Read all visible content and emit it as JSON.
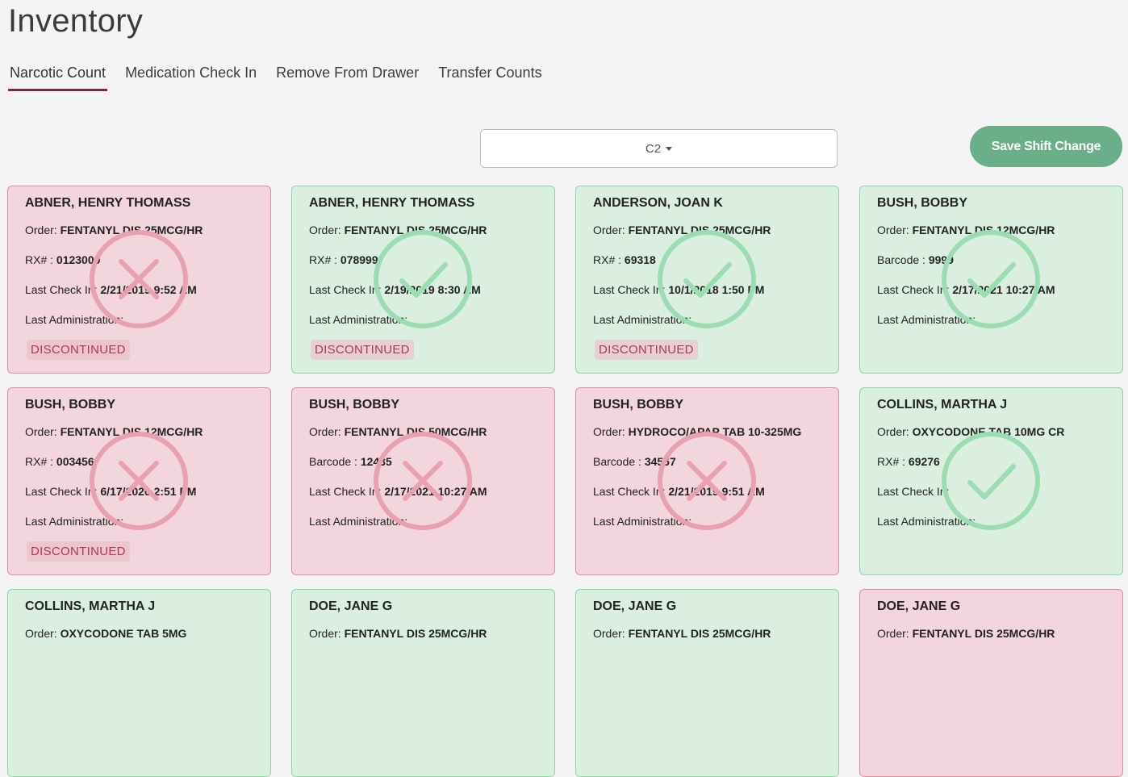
{
  "page": {
    "title": "Inventory"
  },
  "tabs": [
    {
      "label": "Narcotic Count",
      "active": true
    },
    {
      "label": "Medication Check In",
      "active": false
    },
    {
      "label": "Remove From Drawer",
      "active": false
    },
    {
      "label": "Transfer Counts",
      "active": false
    }
  ],
  "drawer_select": {
    "value": "C2"
  },
  "save_button": {
    "label": "Save Shift Change"
  },
  "labels": {
    "order": "Order: ",
    "last_check_in": "Last Check In: ",
    "last_administration": "Last Administration:"
  },
  "colors": {
    "error": "#e8a1b1",
    "success": "#9bdcb0",
    "accent": "#7a2853",
    "button": "#6aae8a"
  },
  "cards": [
    {
      "patient": "ABNER, HENRY THOMASS",
      "order": "FENTANYL DIS 25MCG/HR",
      "id_label": "RX# : ",
      "id_value": "0123000",
      "last_check_in": "2/21/2019 9:52 AM",
      "last_administration": "",
      "status": "bad",
      "badge": "DISCONTINUED",
      "icon": "x-circle-icon"
    },
    {
      "patient": "ABNER, HENRY THOMASS",
      "order": "FENTANYL DIS 25MCG/HR",
      "id_label": "RX# : ",
      "id_value": "078999",
      "last_check_in": "2/19/2019 8:30 AM",
      "last_administration": "",
      "status": "good",
      "badge": "DISCONTINUED",
      "icon": "check-circle-icon"
    },
    {
      "patient": "ANDERSON, JOAN K",
      "order": "FENTANYL DIS 25MCG/HR",
      "id_label": "RX# : ",
      "id_value": "69318",
      "last_check_in": "10/1/2018 1:50 PM",
      "last_administration": "",
      "status": "good",
      "badge": "DISCONTINUED",
      "icon": "check-circle-icon"
    },
    {
      "patient": "BUSH, BOBBY",
      "order": "FENTANYL DIS 12MCG/HR",
      "id_label": "Barcode : ",
      "id_value": "9999",
      "last_check_in": "2/17/2021 10:27 AM",
      "last_administration": "",
      "status": "good",
      "badge": "",
      "icon": "check-circle-icon"
    },
    {
      "patient": "BUSH, BOBBY",
      "order": "FENTANYL DIS 12MCG/HR",
      "id_label": "RX# : ",
      "id_value": "003456",
      "last_check_in": "6/17/2020 2:51 PM",
      "last_administration": "",
      "status": "bad",
      "badge": "DISCONTINUED",
      "icon": "x-circle-icon"
    },
    {
      "patient": "BUSH, BOBBY",
      "order": "FENTANYL DIS 50MCG/HR",
      "id_label": "Barcode : ",
      "id_value": "12435",
      "last_check_in": "2/17/2021 10:27 AM",
      "last_administration": "",
      "status": "bad",
      "badge": "",
      "icon": "x-circle-icon"
    },
    {
      "patient": "BUSH, BOBBY",
      "order": "HYDROCO/APAP TAB 10-325MG",
      "id_label": "Barcode : ",
      "id_value": "34567",
      "last_check_in": "2/21/2019 9:51 AM",
      "last_administration": "",
      "status": "bad",
      "badge": "",
      "icon": "x-circle-icon"
    },
    {
      "patient": "COLLINS, MARTHA J",
      "order": "OXYCODONE TAB 10MG CR",
      "id_label": "RX# : ",
      "id_value": "69276",
      "last_check_in": "",
      "last_administration": "",
      "status": "good",
      "badge": "",
      "icon": "check-circle-icon"
    },
    {
      "patient": "COLLINS, MARTHA J",
      "order": "OXYCODONE TAB 5MG",
      "id_label": "",
      "id_value": "",
      "last_check_in": "",
      "last_administration": "",
      "status": "good",
      "badge": "",
      "icon": "check-circle-icon"
    },
    {
      "patient": "DOE, JANE G",
      "order": "FENTANYL DIS 25MCG/HR",
      "id_label": "",
      "id_value": "",
      "last_check_in": "",
      "last_administration": "",
      "status": "good",
      "badge": "",
      "icon": "check-circle-icon"
    },
    {
      "patient": "DOE, JANE G",
      "order": "FENTANYL DIS 25MCG/HR",
      "id_label": "",
      "id_value": "",
      "last_check_in": "",
      "last_administration": "",
      "status": "good",
      "badge": "",
      "icon": "check-circle-icon"
    },
    {
      "patient": "DOE, JANE G",
      "order": "FENTANYL DIS 25MCG/HR",
      "id_label": "",
      "id_value": "",
      "last_check_in": "",
      "last_administration": "",
      "status": "bad",
      "badge": "",
      "icon": "x-circle-icon"
    }
  ]
}
